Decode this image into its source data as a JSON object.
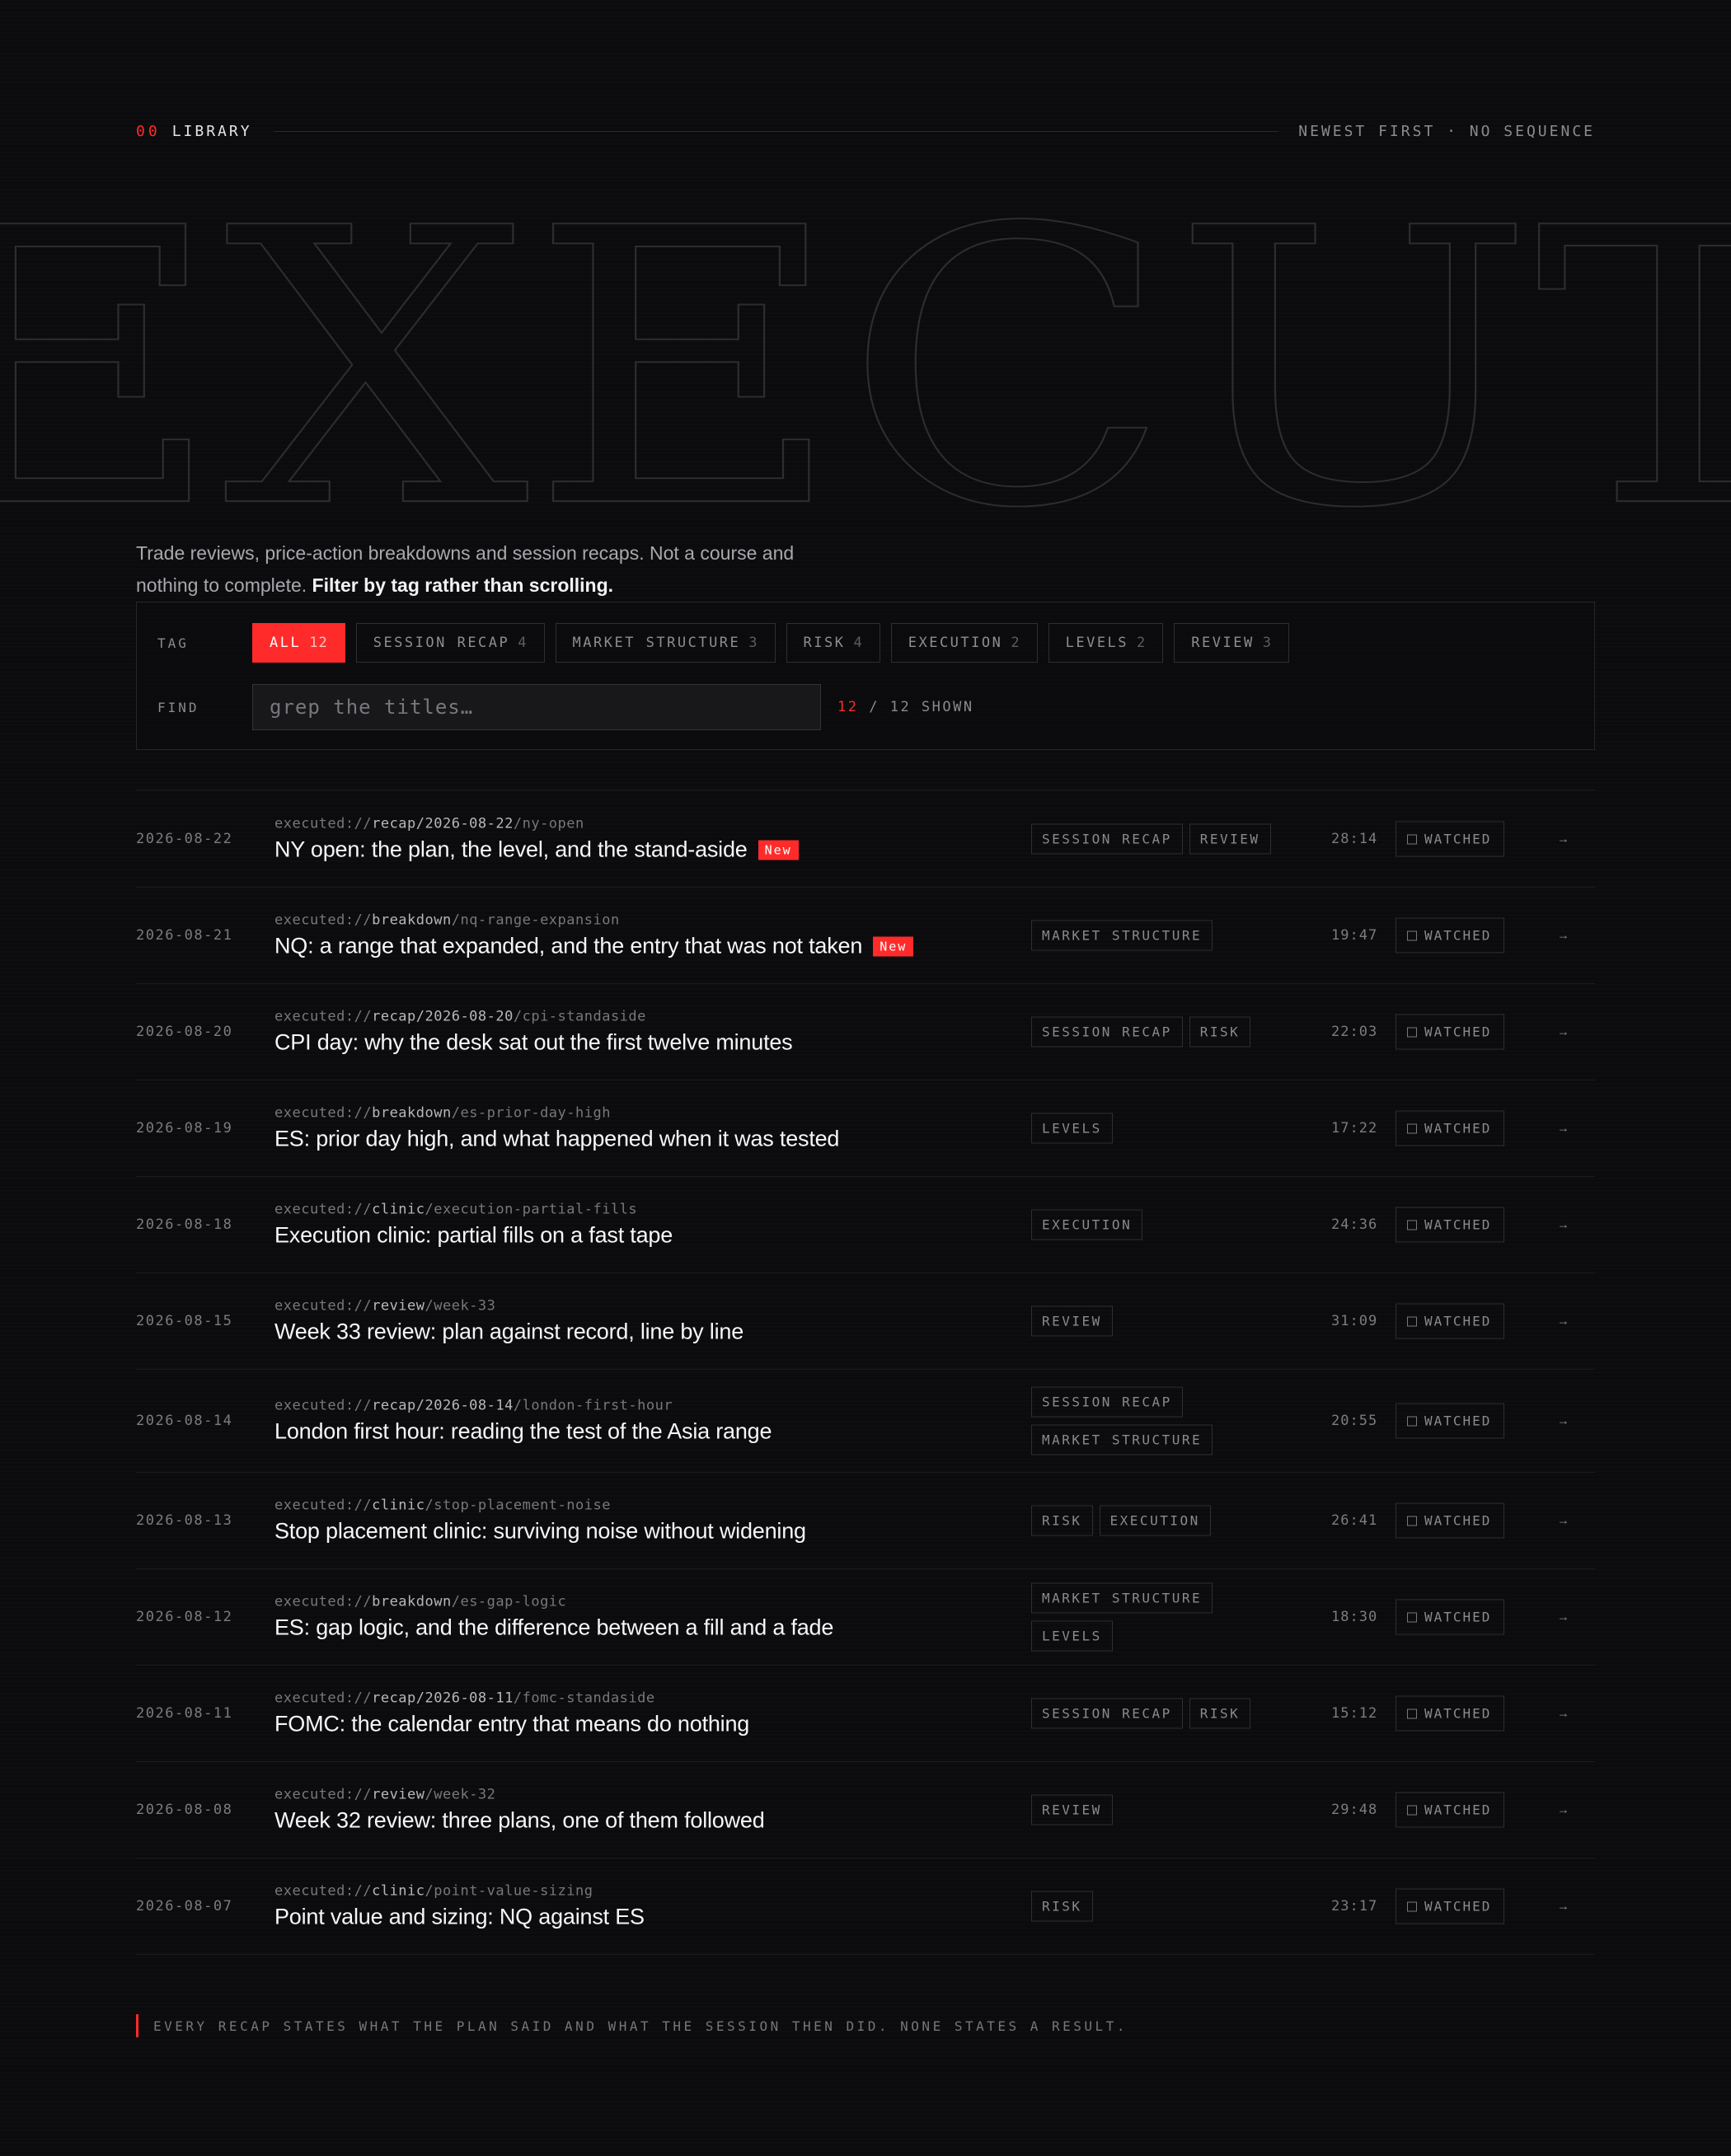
{
  "header": {
    "index": "00",
    "section": "LIBRARY",
    "sort": "NEWEST FIRST · NO SEQUENCE"
  },
  "hero": {
    "word": "EXECUT"
  },
  "intro": {
    "text": "Trade reviews, price-action breakdowns and session recaps. Not a course and nothing to complete.",
    "emphasis": "Filter by tag rather than scrolling."
  },
  "filters": {
    "tag_label": "TAG",
    "find_label": "FIND",
    "placeholder": "grep the titles…",
    "chips": [
      {
        "label": "ALL",
        "count": "12",
        "active": true
      },
      {
        "label": "SESSION RECAP",
        "count": "4"
      },
      {
        "label": "MARKET STRUCTURE",
        "count": "3"
      },
      {
        "label": "RISK",
        "count": "4"
      },
      {
        "label": "EXECUTION",
        "count": "2"
      },
      {
        "label": "LEVELS",
        "count": "2"
      },
      {
        "label": "REVIEW",
        "count": "3"
      }
    ],
    "shown": "12",
    "shown_suffix": "/ 12 SHOWN"
  },
  "videos": [
    {
      "date": "2026-08-22",
      "prefix": "executed://",
      "cat": "recap/2026-08-22",
      "slug": "/ny-open",
      "title": "NY open: the plan, the level, and the stand-aside",
      "badge": "New",
      "tags": [
        "SESSION RECAP",
        "REVIEW"
      ],
      "duration": "28:14",
      "watched": "WATCHED"
    },
    {
      "date": "2026-08-21",
      "prefix": "executed://",
      "cat": "breakdown",
      "slug": "/nq-range-expansion",
      "title": "NQ: a range that expanded, and the entry that was not taken",
      "badge": "New",
      "tags": [
        "MARKET STRUCTURE"
      ],
      "duration": "19:47",
      "watched": "WATCHED"
    },
    {
      "date": "2026-08-20",
      "prefix": "executed://",
      "cat": "recap/2026-08-20",
      "slug": "/cpi-standaside",
      "title": "CPI day: why the desk sat out the first twelve minutes",
      "tags": [
        "SESSION RECAP",
        "RISK"
      ],
      "duration": "22:03",
      "watched": "WATCHED"
    },
    {
      "date": "2026-08-19",
      "prefix": "executed://",
      "cat": "breakdown",
      "slug": "/es-prior-day-high",
      "title": "ES: prior day high, and what happened when it was tested",
      "tags": [
        "LEVELS"
      ],
      "duration": "17:22",
      "watched": "WATCHED"
    },
    {
      "date": "2026-08-18",
      "prefix": "executed://",
      "cat": "clinic",
      "slug": "/execution-partial-fills",
      "title": "Execution clinic: partial fills on a fast tape",
      "tags": [
        "EXECUTION"
      ],
      "duration": "24:36",
      "watched": "WATCHED"
    },
    {
      "date": "2026-08-15",
      "prefix": "executed://",
      "cat": "review",
      "slug": "/week-33",
      "title": "Week 33 review: plan against record, line by line",
      "tags": [
        "REVIEW"
      ],
      "duration": "31:09",
      "watched": "WATCHED"
    },
    {
      "date": "2026-08-14",
      "prefix": "executed://",
      "cat": "recap/2026-08-14",
      "slug": "/london-first-hour",
      "title": "London first hour: reading the test of the Asia range",
      "tags": [
        "SESSION RECAP",
        "MARKET STRUCTURE"
      ],
      "duration": "20:55",
      "watched": "WATCHED"
    },
    {
      "date": "2026-08-13",
      "prefix": "executed://",
      "cat": "clinic",
      "slug": "/stop-placement-noise",
      "title": "Stop placement clinic: surviving noise without widening",
      "tags": [
        "RISK",
        "EXECUTION"
      ],
      "duration": "26:41",
      "watched": "WATCHED"
    },
    {
      "date": "2026-08-12",
      "prefix": "executed://",
      "cat": "breakdown",
      "slug": "/es-gap-logic",
      "title": "ES: gap logic, and the difference between a fill and a fade",
      "tags": [
        "MARKET STRUCTURE",
        "LEVELS"
      ],
      "duration": "18:30",
      "watched": "WATCHED"
    },
    {
      "date": "2026-08-11",
      "prefix": "executed://",
      "cat": "recap/2026-08-11",
      "slug": "/fomc-standaside",
      "title": "FOMC: the calendar entry that means do nothing",
      "tags": [
        "SESSION RECAP",
        "RISK"
      ],
      "duration": "15:12",
      "watched": "WATCHED"
    },
    {
      "date": "2026-08-08",
      "prefix": "executed://",
      "cat": "review",
      "slug": "/week-32",
      "title": "Week 32 review: three plans, one of them followed",
      "tags": [
        "REVIEW"
      ],
      "duration": "29:48",
      "watched": "WATCHED"
    },
    {
      "date": "2026-08-07",
      "prefix": "executed://",
      "cat": "clinic",
      "slug": "/point-value-sizing",
      "title": "Point value and sizing: NQ against ES",
      "tags": [
        "RISK"
      ],
      "duration": "23:17",
      "watched": "WATCHED"
    }
  ],
  "footer": {
    "note": "EVERY RECAP STATES WHAT THE PLAN SAID AND WHAT THE SESSION THEN DID. NONE STATES A RESULT."
  },
  "icons": {
    "row_arrow": "arrow-right-icon",
    "watched_box": "checkbox-icon"
  },
  "colors": {
    "accent": "#ff2b2b",
    "background": "#0b0b0d",
    "border": "#2e2e33"
  }
}
